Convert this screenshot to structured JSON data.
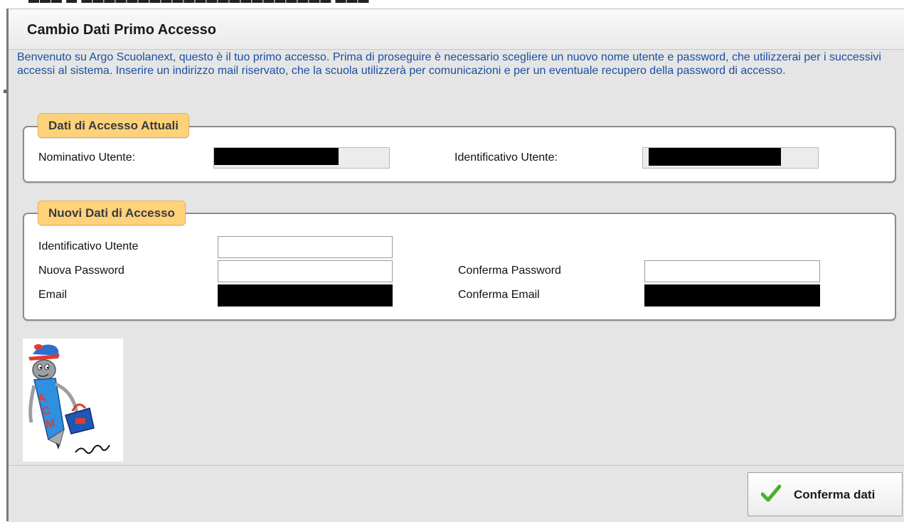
{
  "window": {
    "title": "Cambio Dati Primo Accesso",
    "intro": "Benvenuto su Argo Scuolanext, questo è il tuo primo accesso. Prima di proseguire è necessario scegliere un nuovo nome utente e password, che utilizzerai per i successivi accessi al sistema. Inserire un indirizzo mail riservato, che la scuola utilizzerà per comunicazioni e per un eventuale recupero della password di accesso."
  },
  "current_access": {
    "legend": "Dati di Accesso Attuali",
    "nominativo_label": "Nominativo Utente:",
    "identificativo_label": "Identificativo Utente:"
  },
  "new_access": {
    "legend": "Nuovi Dati di Accesso",
    "identificativo_label": "Identificativo Utente",
    "identificativo_value": "",
    "password_label": "Nuova Password",
    "password_value": "",
    "confirm_password_label": "Conferma Password",
    "confirm_password_value": "",
    "email_label": "Email",
    "confirm_email_label": "Conferma Email"
  },
  "footer": {
    "confirm_button": "Conferma dati"
  },
  "colors": {
    "intro_text": "#1a4fa0",
    "legend_bg": "#fdd27b",
    "check": "#4caf2a"
  },
  "icons": {
    "confirm": "check-icon",
    "mascot": "argo-mascot-logo"
  }
}
